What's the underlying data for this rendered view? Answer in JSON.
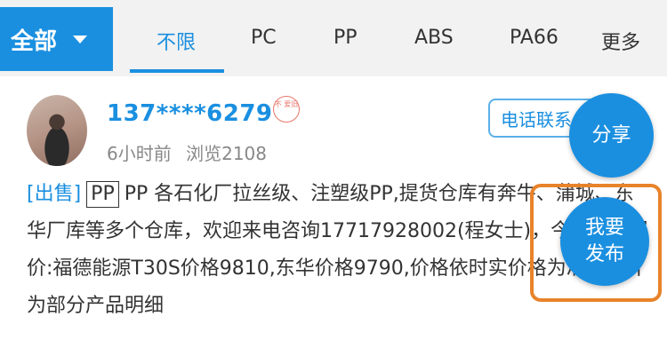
{
  "filter": {
    "all_label": "全部",
    "tabs": [
      {
        "label": "不限",
        "active": true
      },
      {
        "label": "PC",
        "active": false
      },
      {
        "label": "PP",
        "active": false
      },
      {
        "label": "ABS",
        "active": false
      },
      {
        "label": "PA66",
        "active": false
      },
      {
        "label": "更多",
        "active": false
      }
    ]
  },
  "post": {
    "username": "137****6279",
    "stamp_text": "不 爱旧",
    "time": "6小时前",
    "views": "浏览2108",
    "call_label": "电话联系",
    "sale_tag": "[出售]",
    "category_tag": "PP",
    "body": "PP 各石化厂拉丝级、注塑级PP,提货仓库有奔牛、蒲城、东华厂库等多个仓库，欢迎来电咨询17717928002(程女士)，今日部分报价:福德能源T30S价格9810,东华价格9790,价格依时实价格为准，图片为部分产品明细"
  },
  "actions": {
    "share_label": "分享",
    "publish_label_line1": "我要",
    "publish_label_line2": "发布"
  },
  "colors": {
    "accent": "#1a8fe0",
    "highlight": "#e8832a"
  }
}
